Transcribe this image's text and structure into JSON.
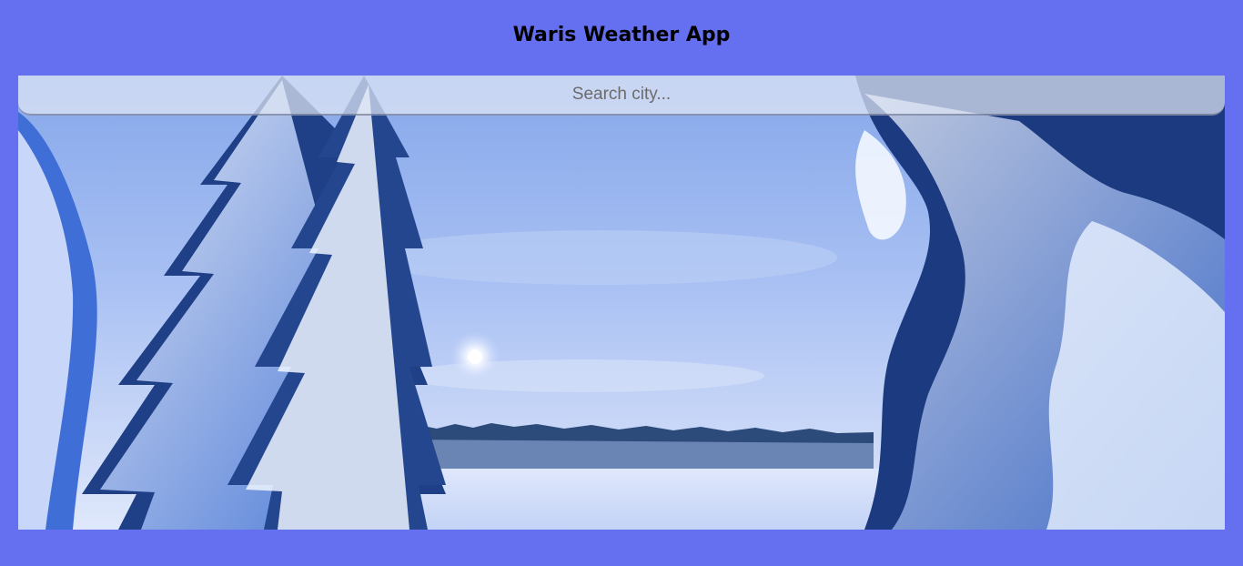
{
  "header": {
    "title": "Waris Weather App"
  },
  "search": {
    "placeholder": "Search city..."
  },
  "background": {
    "scene": "snowy-forest-moonlit-lake",
    "page_color": "#6470f0"
  }
}
